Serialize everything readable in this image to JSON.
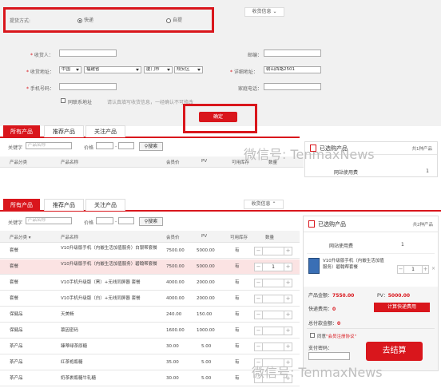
{
  "top": {
    "delivery": {
      "label": "提货方式:",
      "option_express": "快递",
      "option_pickup": "自提"
    },
    "receiver_info_tab": "收货信息",
    "form": {
      "name_label": "收货人：",
      "address_label": "收货地址：",
      "country": "中国",
      "province": "福建省",
      "city": "厦门市",
      "district": "翔安区",
      "phone_label": "手机号码：",
      "same_contact": "同联系地址",
      "hint": "请认真填写收货信息，一经确认不可修改",
      "postcode_label": "邮编：",
      "detail_label": "详细地址：",
      "detail_value": "朝山西路2501",
      "home_phone_label": "家庭电话："
    },
    "confirm_label": "确定",
    "tabs": [
      "所有产品",
      "推荐产品",
      "关注产品"
    ],
    "search": {
      "keyword_label": "关键字",
      "keyword_placeholder": "产品名称",
      "price_label": "价格",
      "dash": "-",
      "button": "搜索"
    },
    "columns": [
      "产品分类",
      "产品名称",
      "会员价",
      "PV",
      "可用库存",
      "数量"
    ],
    "cart": {
      "title": "已选购产品",
      "count": "共1种产品",
      "item": "网站使用费",
      "qty": "1"
    },
    "watermark": "微信号: TenmaxNews"
  },
  "bottom": {
    "tabs": [
      "所有产品",
      "推荐产品",
      "关注产品"
    ],
    "receiver_info_tab": "收货信息",
    "search": {
      "keyword_label": "关键字",
      "keyword_placeholder": "产品名称",
      "price_label": "价格",
      "dash": "-",
      "button": "搜索"
    },
    "columns": [
      "产品分类",
      "产品名称",
      "会员价",
      "PV",
      "可用库存",
      "数量"
    ],
    "rows": [
      {
        "category": "套餐",
        "name": "V10升级版手机（内嵌生活加值服务）白银帮套餐",
        "price": "7500.00",
        "pv": "5000.00",
        "stock": "有",
        "qty": ""
      },
      {
        "category": "套餐",
        "name": "V10升级版手机（内嵌生活加值服务）碧翰帮套餐",
        "price": "7500.00",
        "pv": "5000.00",
        "stock": "有",
        "qty": "1"
      },
      {
        "category": "套餐",
        "name": "V10手机升级版（黑）+无线同屏器 套餐",
        "price": "4000.00",
        "pv": "2000.00",
        "stock": "有",
        "qty": ""
      },
      {
        "category": "套餐",
        "name": "V10手机升级版（白）+无线同屏器 套餐",
        "price": "4000.00",
        "pv": "2000.00",
        "stock": "有",
        "qty": ""
      },
      {
        "category": "保健品",
        "name": "天美畅",
        "price": "240.00",
        "pv": "150.00",
        "stock": "有",
        "qty": ""
      },
      {
        "category": "保健品",
        "name": "慕因密码",
        "price": "1600.00",
        "pv": "1000.00",
        "stock": "有",
        "qty": ""
      },
      {
        "category": "茶产品",
        "name": "臻蒂绿茶原糖",
        "price": "30.00",
        "pv": "5.00",
        "stock": "有",
        "qty": ""
      },
      {
        "category": "茶产品",
        "name": "红茶袍瓶糖",
        "price": "35.00",
        "pv": "5.00",
        "stock": "有",
        "qty": ""
      },
      {
        "category": "茶产品",
        "name": "奶茶裹瓶糖牛轧糖",
        "price": "30.00",
        "pv": "5.00",
        "stock": "有",
        "qty": ""
      }
    ],
    "cart": {
      "title": "已选购产品",
      "count": "共2种产品",
      "item1_name": "网站使用费",
      "item1_qty": "1",
      "item2_name": "V10升级版手机（内嵌生活加值服务）碧翰帮套餐",
      "item2_qty": "1",
      "amount_label": "产品金额：",
      "amount_value": "7550.00",
      "pv_label": "PV：",
      "pv_value": "5000.00",
      "shipping_label": "快递费用：",
      "shipping_value": "0",
      "calc_button": "计算快递费用",
      "total_label": "总付款金额：",
      "total_value": "0",
      "agree_prefix": "同意",
      "agree_link": "\"会员注册协议\"",
      "password_label": "支付密码：",
      "checkout_button": "去结算"
    },
    "watermark": "微信号: TenmaxNews"
  },
  "colors": {
    "accent": "#d9161c",
    "panel": "#f1f1f1",
    "highlight_row": "#fbe3e3"
  }
}
